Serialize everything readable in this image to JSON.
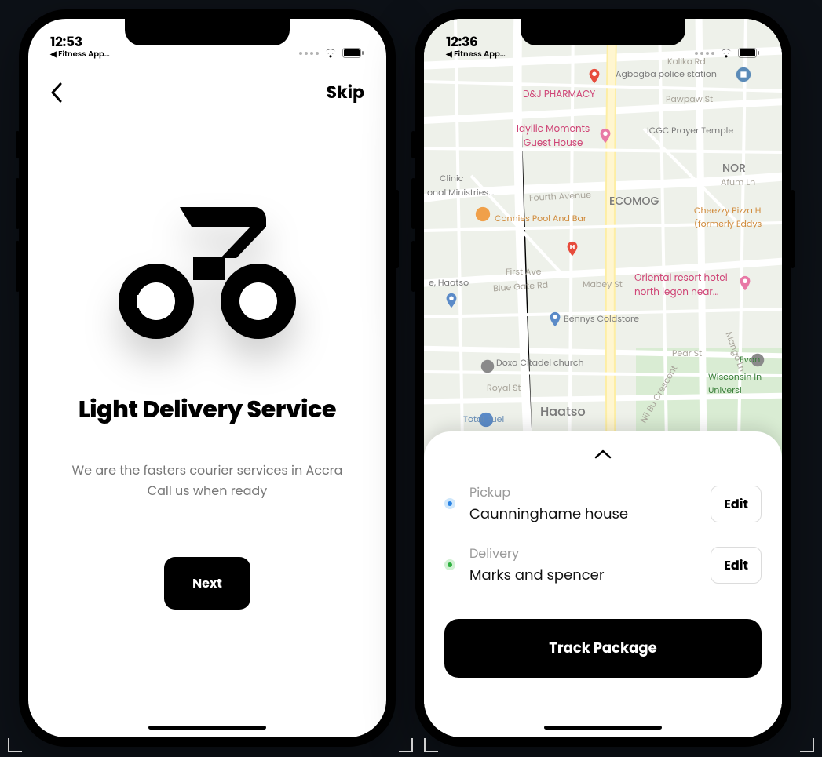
{
  "screen1": {
    "status": {
      "time": "12:53",
      "back_app": "◀ Fitness App…"
    },
    "skip_label": "Skip",
    "title": "Light Delivery Service",
    "subtitle_line1": "We are the fasters courier services in Accra",
    "subtitle_line2": "Call us when ready",
    "next_label": "Next"
  },
  "screen2": {
    "status": {
      "time": "12:36",
      "back_app": "◀ Fitness App…"
    },
    "sheet": {
      "pickup_label": "Pickup",
      "pickup_value": "Caunninghame house",
      "delivery_label": "Delivery",
      "delivery_value": "Marks and spencer",
      "edit_label": "Edit",
      "track_label": "Track Package"
    },
    "map_labels": {
      "dj_pharmacy": "D&J PHARMACY",
      "agbogba": "Agbogba police station",
      "koliko": "Koliko Rd",
      "pawpaw": "Pawpaw St",
      "idyllic": "Idyllic Moments\nGuest House",
      "icgc": "ICGC Prayer Temple",
      "nor": "NOR",
      "clinic": "Clinic",
      "ministries": "onal Ministries...",
      "fourth": "Fourth Avenue",
      "ecomog": "ECOMOG",
      "afum": "Afum Ln",
      "connies": "Connies Pool And Bar",
      "cheezzy": "Cheezzy Pizza H\n(formerly Eddys",
      "first": "First Ave",
      "bluegate": "Blue Gate Rd",
      "mabey": "Mabey St",
      "oriental": "Oriental resort hotel\nnorth legon near...",
      "haatso_left": "e, Haatso",
      "bennys": "Bennys Coldstore",
      "pear": "Pear St",
      "doxa": "Doxa Citadel church",
      "mango": "Mango Ln",
      "evan": "Evan",
      "wisconsin": "Wisconsin In\nUniversi",
      "royal": "Royal St",
      "nii": "Nii Bu Crescent",
      "haatso": "Haatso",
      "total": "Total Fuel"
    }
  }
}
